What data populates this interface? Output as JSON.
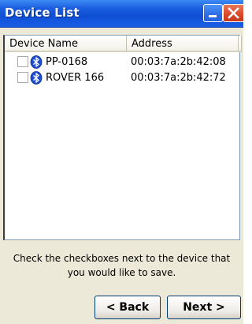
{
  "window": {
    "title": "Device List"
  },
  "listview": {
    "columns": [
      "Device Name",
      "Address"
    ],
    "rows": [
      {
        "name": "PP-0168",
        "address": "00:03:7a:2b:42:08",
        "checked": false,
        "icon": "bluetooth-icon"
      },
      {
        "name": "ROVER 166",
        "address": "00:03:7a:2b:42:72",
        "checked": false,
        "icon": "bluetooth-icon"
      }
    ]
  },
  "instruction": {
    "line1": "Check the checkboxes next to the device that",
    "line2": "you would like to save."
  },
  "buttons": {
    "back": "< Back",
    "next": "Next >"
  },
  "colors": {
    "titlebar": "#1c5fe0",
    "close_button": "#d9492a",
    "bluetooth": "#1f4fcf"
  }
}
